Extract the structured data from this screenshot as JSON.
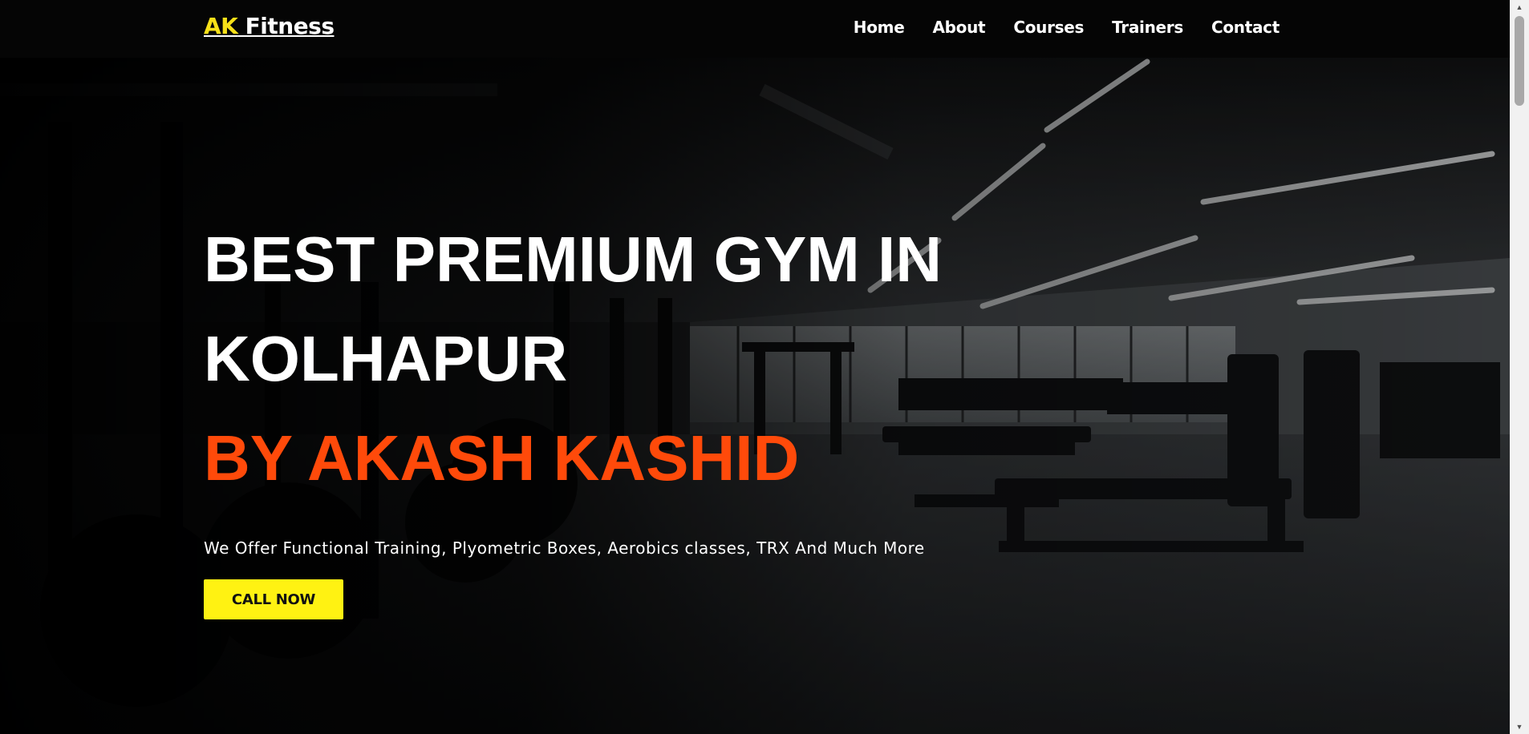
{
  "nav": {
    "logo_accent": "AK",
    "logo_rest": " Fitness",
    "links": [
      "Home",
      "About",
      "Courses",
      "Trainers",
      "Contact"
    ]
  },
  "hero": {
    "headline_line1": "BEST PREMIUM GYM IN",
    "headline_line2": "KOLHAPUR",
    "headline_accent": "BY AKASH KASHID",
    "subtitle": "We Offer Functional Training, Plyometric Boxes, Aerobics classes, TRX And Much More",
    "cta_label": "CALL NOW",
    "background_image": "gym-interior-photo"
  },
  "colors": {
    "logo_accent": "#f7e018",
    "headline_accent": "#ff4a0a",
    "cta_background": "#fff212",
    "navbar_background": "#050505"
  },
  "icons": {
    "scroll_up": "triangle-up-icon",
    "scroll_down": "triangle-down-icon"
  }
}
